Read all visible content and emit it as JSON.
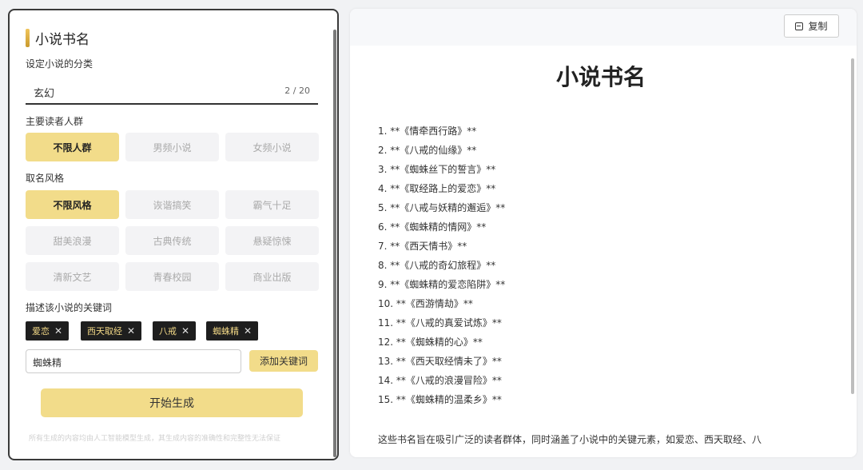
{
  "left": {
    "title": "小说书名",
    "category_label": "设定小说的分类",
    "category_value": "玄幻",
    "category_counter": "2 / 20",
    "audience_label": "主要读者人群",
    "audience_options": [
      "不限人群",
      "男频小说",
      "女频小说"
    ],
    "style_label": "取名风格",
    "style_options": [
      "不限风格",
      "诙谐搞笑",
      "霸气十足",
      "甜美浪漫",
      "古典传统",
      "悬疑惊悚",
      "清新文艺",
      "青春校园",
      "商业出版"
    ],
    "keywords_label": "描述该小说的关键词",
    "keywords": [
      "爱恋",
      "西天取经",
      "八戒",
      "蜘蛛精"
    ],
    "keyword_input_value": "蜘蛛精",
    "add_keyword_button": "添加关键词",
    "generate_button": "开始生成",
    "footer_note": "所有生成的内容均由人工智能模型生成，其生成内容的准确性和完整性无法保证"
  },
  "right": {
    "copy_button": "复制",
    "doc_title": "小说书名",
    "items": [
      "1. **《情牵西行路》**",
      "2. **《八戒的仙缘》**",
      "3. **《蜘蛛丝下的誓言》**",
      "4. **《取经路上的爱恋》**",
      "5. **《八戒与妖精的邂逅》**",
      "6. **《蜘蛛精的情网》**",
      "7. **《西天情书》**",
      "8. **《八戒的奇幻旅程》**",
      "9. **《蜘蛛精的爱恋陷阱》**",
      "10. **《西游情劫》**",
      "11. **《八戒的真爱试炼》**",
      "12. **《蜘蛛精的心》**",
      "13. **《西天取经情未了》**",
      "14. **《八戒的浪漫冒险》**",
      "15. **《蜘蛛精的温柔乡》**"
    ],
    "summary": "这些书名旨在吸引广泛的读者群体，同时涵盖了小说中的关键元素，如爱恋、西天取经、八"
  },
  "colors": {
    "accent": "#f2dc8a",
    "tag_bg": "#1e1e1e",
    "tag_text": "#f2d886"
  }
}
